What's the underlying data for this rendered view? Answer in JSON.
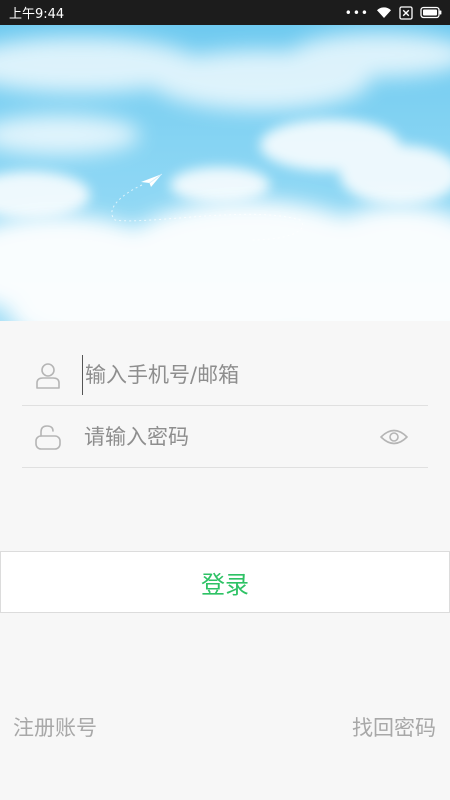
{
  "status_bar": {
    "time": "上午9:44",
    "dots": "•••",
    "wifi_icon": "wifi-icon",
    "sim_icon": "no-sim-icon",
    "battery_icon": "battery-icon"
  },
  "banner": {
    "image": "sky-with-clouds",
    "icon": "paper-plane-icon"
  },
  "form": {
    "account": {
      "icon": "user-icon",
      "placeholder": "输入手机号/邮箱",
      "value": ""
    },
    "password": {
      "icon": "unlock-icon",
      "placeholder": "请输入密码",
      "value": "",
      "toggle_icon": "eye-icon"
    }
  },
  "login_button": {
    "label": "登录"
  },
  "links": {
    "register": "注册账号",
    "forgot_password": "找回密码"
  },
  "colors": {
    "status_bar_bg": "#1c1c1c",
    "page_bg": "#f7f7f7",
    "accent_green": "#2ec265",
    "placeholder": "#8e8e8e",
    "link_gray": "#a8a8a8",
    "sky_blue": "#86d4f3"
  }
}
